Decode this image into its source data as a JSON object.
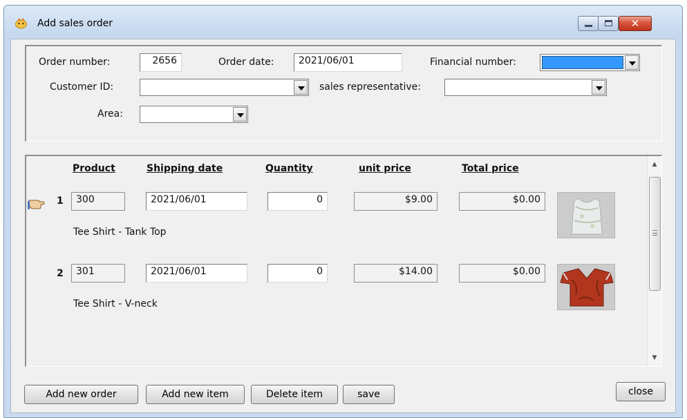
{
  "window": {
    "title": "Add sales order",
    "accent_color": "#c0331d"
  },
  "header": {
    "order_number_label": "Order number:",
    "order_number_value": "2656",
    "order_date_label": "Order date:",
    "order_date_value": "2021/06/01",
    "financial_number_label": "Financial number:",
    "financial_number_value": "",
    "customer_id_label": "Customer ID:",
    "customer_id_value": "",
    "sales_rep_label": "sales representative:",
    "sales_rep_value": "",
    "area_label": "Area:",
    "area_value": ""
  },
  "items": {
    "columns": [
      "Product",
      "Shipping date",
      "Quantity",
      "unit price",
      "Total price"
    ],
    "rows": [
      {
        "number": "1",
        "product": "300",
        "shipping_date": "2021/06/01",
        "quantity": "0",
        "unit_price": "$9.00",
        "total_price": "$0.00",
        "description": "Tee Shirt - Tank Top",
        "image_icon": "tank-top-shirt-icon"
      },
      {
        "number": "2",
        "product": "301",
        "shipping_date": "2021/06/01",
        "quantity": "0",
        "unit_price": "$14.00",
        "total_price": "$0.00",
        "description": "Tee Shirt - V-neck",
        "image_icon": "vneck-shirt-icon"
      }
    ]
  },
  "buttons": {
    "add_new_order": "Add new order",
    "add_new_item": "Add new item",
    "delete_item": "Delete item",
    "save": "save",
    "close": "close"
  }
}
